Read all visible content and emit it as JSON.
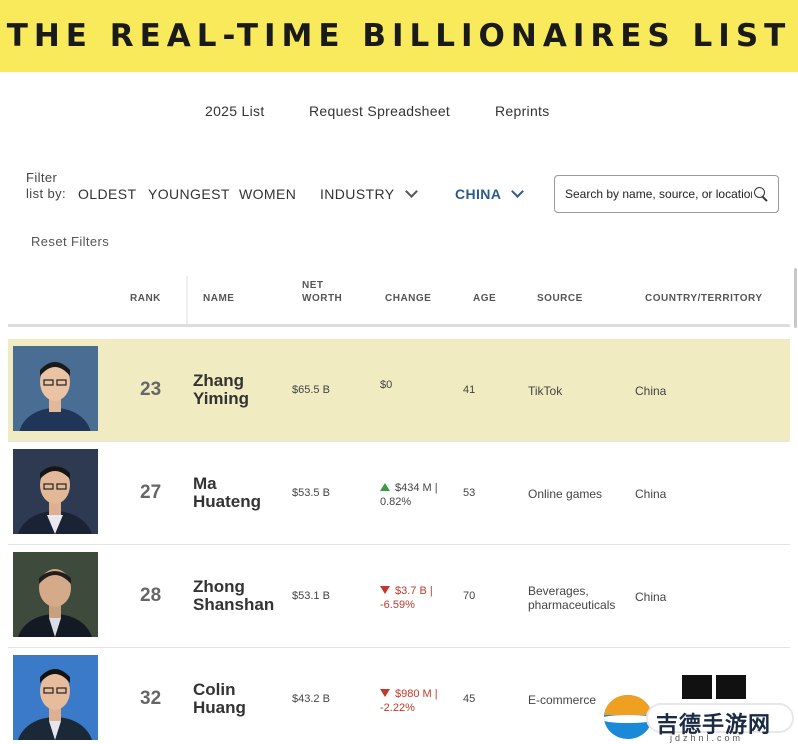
{
  "banner": {
    "title": "THE REAL-TIME BILLIONAIRES LIST"
  },
  "topnav": {
    "list_2025": "2025 List",
    "request": "Request Spreadsheet",
    "reprints": "Reprints"
  },
  "filters": {
    "label": "Filter list by:",
    "oldest": "OLDEST",
    "youngest": "YOUNGEST",
    "women": "WOMEN",
    "industry": "INDUSTRY",
    "country": "CHINA",
    "search_placeholder": "Search by name, source, or location",
    "reset": "Reset Filters"
  },
  "table": {
    "headers": {
      "rank": "RANK",
      "name": "NAME",
      "net_worth_1": "NET",
      "net_worth_2": "WORTH",
      "change": "CHANGE",
      "age": "AGE",
      "source": "SOURCE",
      "country": "COUNTRY/TERRITORY"
    },
    "rows": [
      {
        "rank": "23",
        "first": "Zhang",
        "last": "Yiming",
        "worth": "$65.5 B",
        "change": "$0",
        "direction": "none",
        "age": "41",
        "source": "TikTok",
        "country": "China"
      },
      {
        "rank": "27",
        "first": "Ma",
        "last": "Huateng",
        "worth": "$53.5 B",
        "change": "$434 M | 0.82%",
        "direction": "up",
        "age": "53",
        "source": "Online games",
        "country": "China"
      },
      {
        "rank": "28",
        "first": "Zhong",
        "last": "Shanshan",
        "worth": "$53.1 B",
        "change": "$3.7 B | -6.59%",
        "direction": "down",
        "age": "70",
        "source": "Beverages, pharmaceuticals",
        "country": "China"
      },
      {
        "rank": "32",
        "first": "Colin",
        "last": "Huang",
        "worth": "$43.2 B",
        "change": "$980 M | -2.22%",
        "direction": "down",
        "age": "45",
        "source": "E-commerce",
        "country": ""
      }
    ]
  },
  "watermark": {
    "text": "吉德手游网",
    "sub": "jdzhnl.com"
  },
  "colors": {
    "banner": "#f8ea5a",
    "highlight_row": "#f0ebc0",
    "active_filter": "#2e5a8a",
    "up": "#3a9a4a",
    "down": "#c0392b"
  }
}
